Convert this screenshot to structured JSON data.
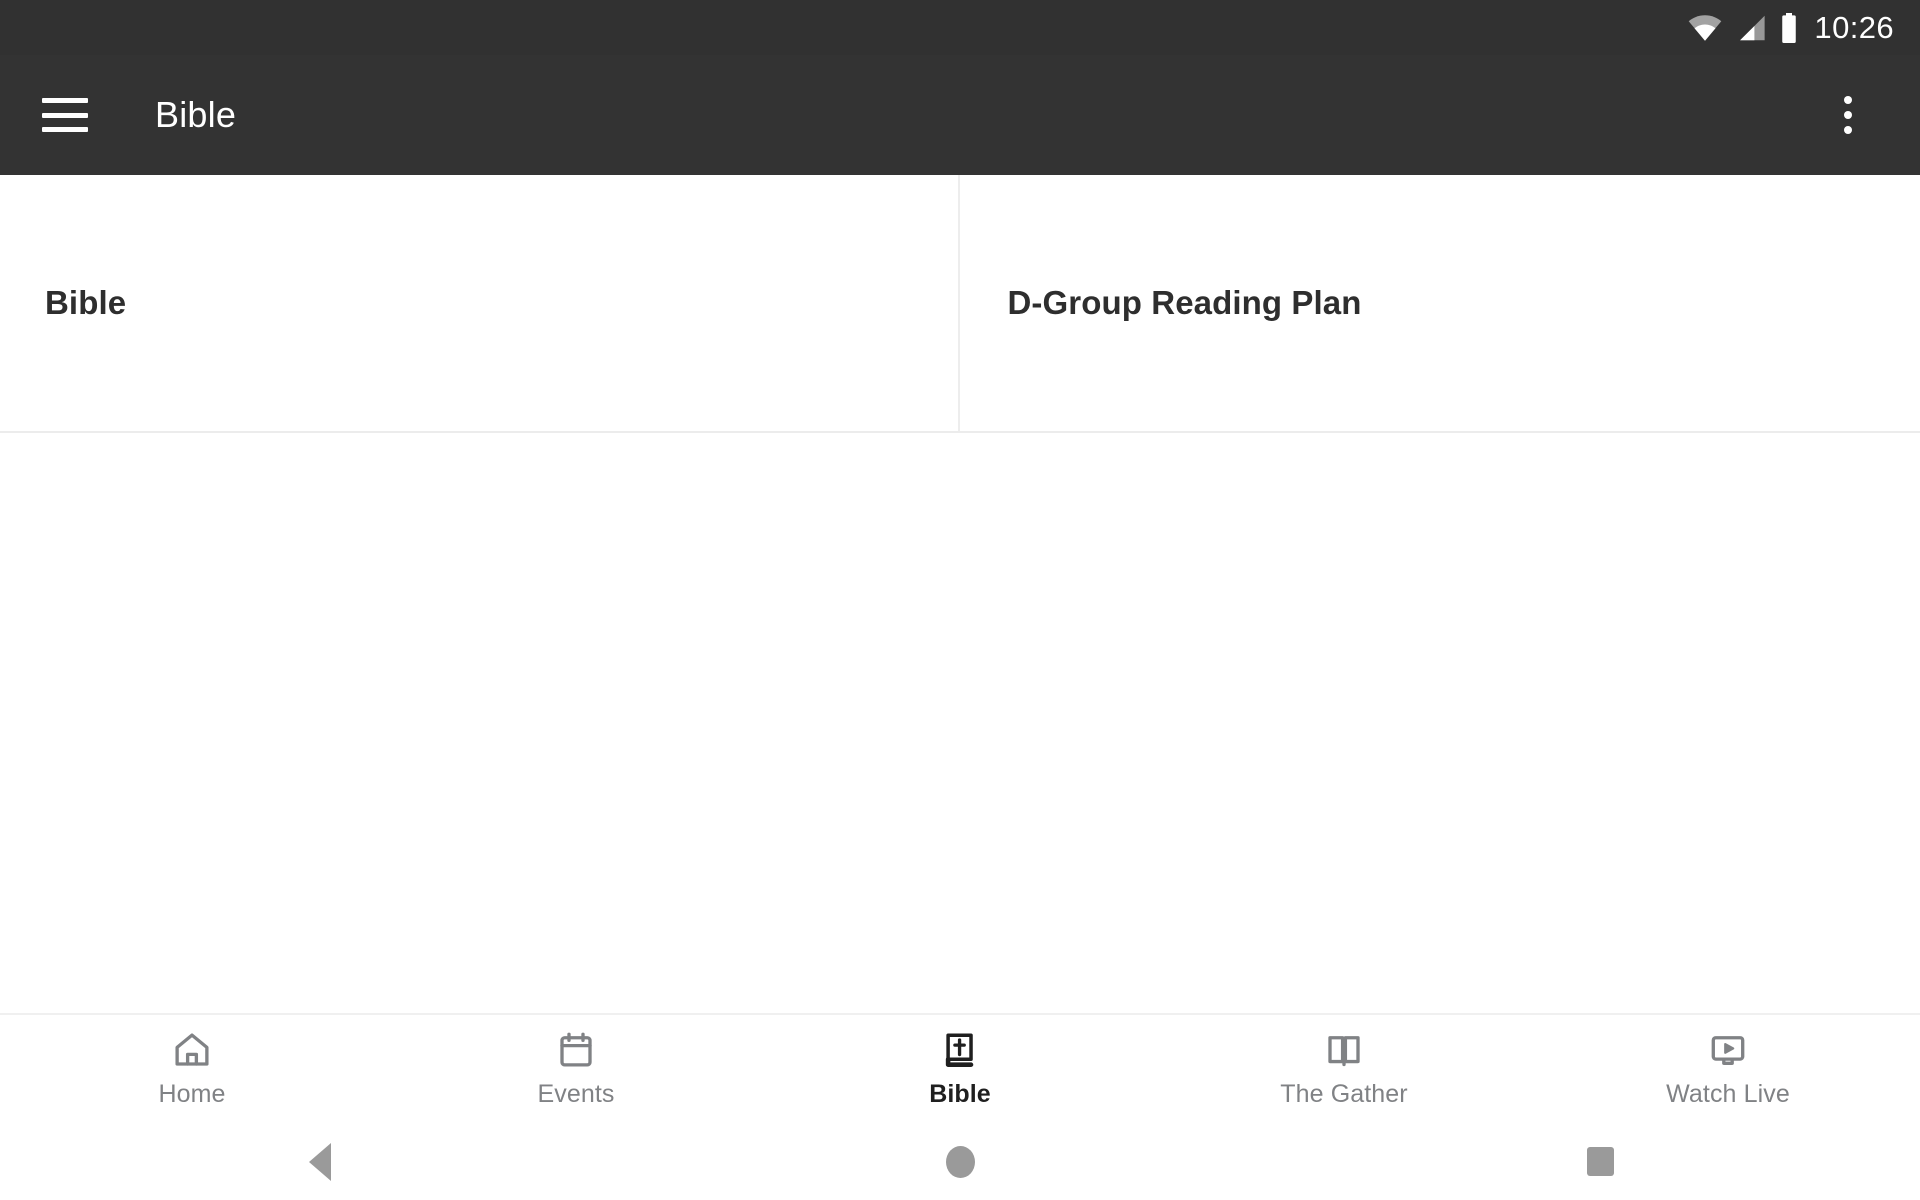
{
  "status_bar": {
    "time": "10:26",
    "icons": [
      "wifi-icon",
      "cell-signal-icon",
      "battery-icon"
    ],
    "background": "#313131"
  },
  "app_bar": {
    "menu_icon": "hamburger-menu-icon",
    "title": "Bible",
    "overflow_icon": "overflow-menu-icon",
    "background": "#333333",
    "text_color": "#ffffff"
  },
  "content": {
    "cells": [
      {
        "title": "Bible"
      },
      {
        "title": "D-Group Reading Plan"
      }
    ],
    "divider_color": "#ececec",
    "background": "#ffffff"
  },
  "bottom_nav": {
    "active_index": 2,
    "inactive_color": "#808285",
    "active_color": "#1f1f1f",
    "items": [
      {
        "label": "Home",
        "icon": "home-icon"
      },
      {
        "label": "Events",
        "icon": "calendar-icon"
      },
      {
        "label": "Bible",
        "icon": "bible-book-icon"
      },
      {
        "label": "The Gather",
        "icon": "open-book-icon"
      },
      {
        "label": "Watch Live",
        "icon": "video-monitor-icon"
      }
    ]
  },
  "system_nav": {
    "buttons": [
      {
        "name": "back",
        "icon": "back-triangle-icon"
      },
      {
        "name": "home",
        "icon": "home-circle-icon"
      },
      {
        "name": "recents",
        "icon": "recents-square-icon"
      }
    ],
    "color": "#9a9a9a"
  }
}
